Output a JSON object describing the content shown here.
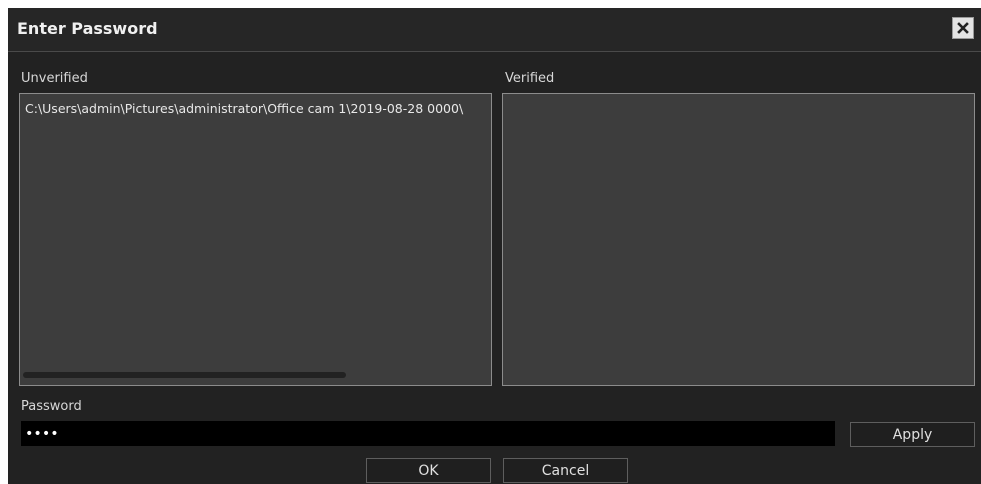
{
  "dialog": {
    "title": "Enter Password",
    "close_icon": "close-icon"
  },
  "unverified": {
    "label": "Unverified",
    "items": [
      "C:\\Users\\admin\\Pictures\\administrator\\Office cam 1\\2019-08-28 0000\\"
    ]
  },
  "verified": {
    "label": "Verified",
    "items": []
  },
  "password": {
    "label": "Password",
    "value": "••••"
  },
  "buttons": {
    "apply": "Apply",
    "ok": "OK",
    "cancel": "Cancel"
  },
  "colors": {
    "dialog_bg": "#222222",
    "panel_bg": "#3d3d3d",
    "input_bg": "#000000",
    "text": "#e0e0e0"
  }
}
